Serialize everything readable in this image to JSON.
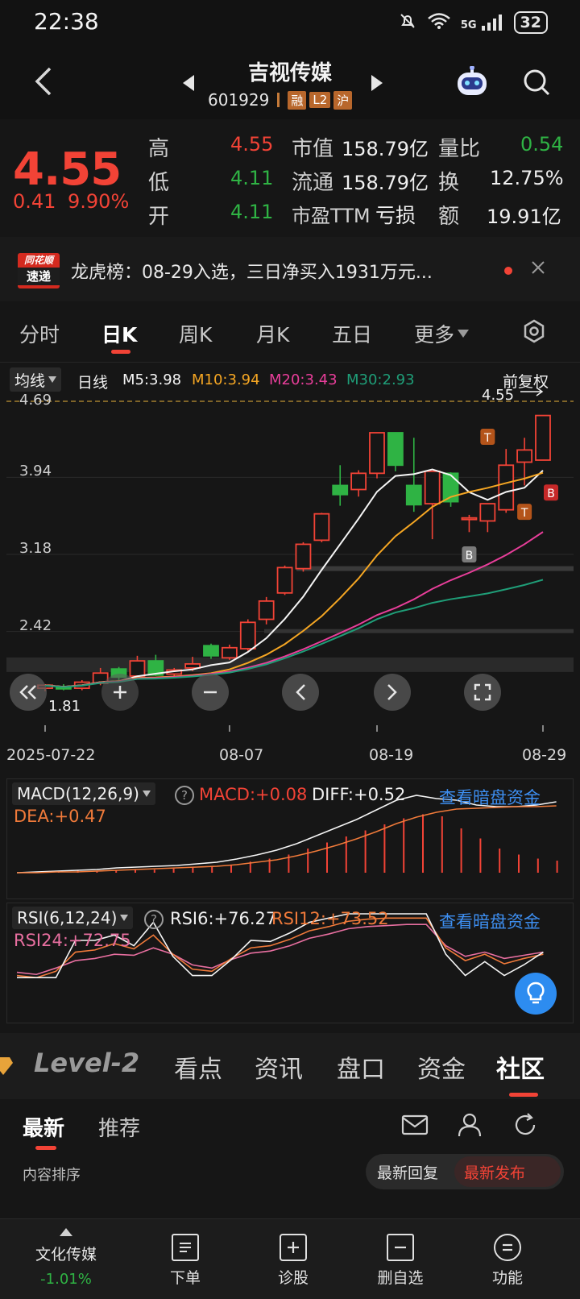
{
  "status_bar": {
    "time": "22:38",
    "network": "5G",
    "battery": "32"
  },
  "nav": {
    "title": "吉视传媒",
    "code": "601929",
    "badges": [
      "融",
      "L2",
      "沪"
    ]
  },
  "quote": {
    "price": "4.55",
    "change": "0.41",
    "change_pct": "9.90%",
    "high_label": "高",
    "high": "4.55",
    "low_label": "低",
    "low": "4.11",
    "open_label": "开",
    "open": "4.11",
    "mktcap_label": "市值",
    "mktcap": "158.79亿",
    "float_label": "流通",
    "float": "158.79亿",
    "pe_label": "市盈TTM",
    "pe": "亏损",
    "volratio_label": "量比",
    "volratio": "0.54",
    "turnover_label": "换",
    "turnover": "12.75%",
    "amount_label": "额",
    "amount": "19.91亿"
  },
  "news": {
    "logo_top": "同花顺",
    "logo_bottom": "速递",
    "text": "龙虎榜：08-29入选，三日净买入1931万元..."
  },
  "ktabs": [
    "分时",
    "日K",
    "周K",
    "月K",
    "五日",
    "更多"
  ],
  "ma_legend": {
    "type": "均线",
    "period": "日线",
    "m5": "M5:3.98",
    "m10": "M10:3.94",
    "m20": "M20:3.43",
    "m30": "M30:2.93",
    "adjust": "前复权"
  },
  "chart_data": {
    "type": "candlestick",
    "y_ticks": [
      "4.69",
      "3.94",
      "3.18",
      "2.42"
    ],
    "ylim": [
      1.67,
      4.69
    ],
    "last_price_label": "4.55",
    "min_price_label": "1.81",
    "x_ticks": [
      "2025-07-22",
      "08-07",
      "08-19",
      "08-29"
    ],
    "candles": [
      [
        1.86,
        1.89,
        1.83,
        1.9
      ],
      [
        1.87,
        1.86,
        1.84,
        1.9
      ],
      [
        1.86,
        1.92,
        1.84,
        1.94
      ],
      [
        1.91,
        2.01,
        1.89,
        2.06
      ],
      [
        2.05,
        1.97,
        1.94,
        2.07
      ],
      [
        1.98,
        2.13,
        1.95,
        2.18
      ],
      [
        2.13,
        1.99,
        1.98,
        2.19
      ],
      [
        2.0,
        2.04,
        1.96,
        2.06
      ],
      [
        2.06,
        2.1,
        2.03,
        2.17
      ],
      [
        2.28,
        2.18,
        2.15,
        2.3
      ],
      [
        2.16,
        2.26,
        2.14,
        2.29
      ],
      [
        2.25,
        2.51,
        2.23,
        2.54
      ],
      [
        2.54,
        2.72,
        2.49,
        2.76
      ],
      [
        2.8,
        3.05,
        2.78,
        3.07
      ],
      [
        3.04,
        3.28,
        3.01,
        3.3
      ],
      [
        3.32,
        3.58,
        3.3,
        3.59
      ],
      [
        3.86,
        3.77,
        3.66,
        4.06
      ],
      [
        3.82,
        3.98,
        3.75,
        4.01
      ],
      [
        3.98,
        4.38,
        3.93,
        4.38
      ],
      [
        4.38,
        4.06,
        4.0,
        4.38
      ],
      [
        3.86,
        3.67,
        3.6,
        4.33
      ],
      [
        3.68,
        4.0,
        3.33,
        4.0
      ],
      [
        3.98,
        3.7,
        3.65,
        3.99
      ],
      [
        3.54,
        3.54,
        3.4,
        3.57
      ],
      [
        3.51,
        3.68,
        3.4,
        3.68
      ],
      [
        3.62,
        4.06,
        3.59,
        4.22
      ],
      [
        4.09,
        4.21,
        3.86,
        4.33
      ],
      [
        4.11,
        4.55,
        4.11,
        4.55
      ]
    ],
    "series": [
      {
        "name": "M5",
        "color": "#f5f5f5"
      },
      {
        "name": "M10",
        "color": "#f5a623"
      },
      {
        "name": "M20",
        "color": "#e83e9a"
      },
      {
        "name": "M30",
        "color": "#1f9e78"
      }
    ],
    "markers": [
      "T",
      "T",
      "B",
      "B"
    ]
  },
  "chart_controls": [
    "zoom-in",
    "zoom-out",
    "prev",
    "next",
    "fullscreen"
  ],
  "macd": {
    "title": "MACD(12,26,9)",
    "macd": "MACD:+0.08",
    "diff": "DIFF:+0.52",
    "dea": "DEA:+0.47",
    "link": "查看暗盘资金"
  },
  "rsi": {
    "title": "RSI(6,12,24)",
    "rsi6": "RSI6:+76.27",
    "rsi12": "RSI12:+73.52",
    "rsi24": "RSI24:+72.75",
    "link": "查看暗盘资金"
  },
  "l2tabs": {
    "brand": "Level-2",
    "items": [
      "看点",
      "资讯",
      "盘口",
      "资金",
      "社区"
    ]
  },
  "subtabs": {
    "items": [
      "最新",
      "推荐"
    ],
    "sort_label": "内容排序",
    "sort_options": [
      "最新回复",
      "最新发布"
    ]
  },
  "bottom_nav": {
    "stock_name": "文化传媒",
    "stock_change": "-1.01%",
    "items": [
      "下单",
      "诊股",
      "删自选",
      "功能"
    ]
  }
}
